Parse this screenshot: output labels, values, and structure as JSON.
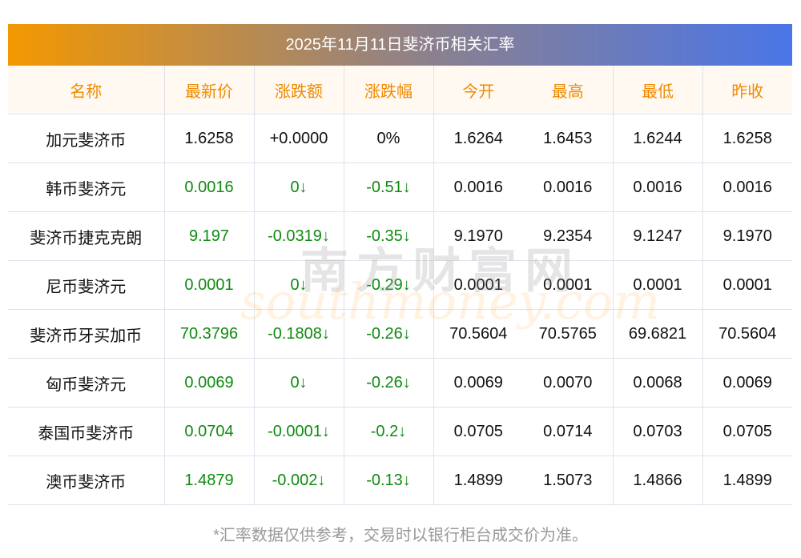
{
  "title": "2025年11月11日斐济币相关汇率",
  "headers": [
    "名称",
    "最新价",
    "涨跌额",
    "涨跌幅",
    "今开",
    "最高",
    "最低",
    "昨收"
  ],
  "rows": [
    [
      "加元斐济币",
      "1.6258",
      "+0.0000",
      "0%",
      "1.6264",
      "1.6453",
      "1.6244",
      "1.6258"
    ],
    [
      "韩币斐济元",
      "0.0016",
      "0↓",
      "-0.51↓",
      "0.0016",
      "0.0016",
      "0.0016",
      "0.0016"
    ],
    [
      "斐济币捷克克朗",
      "9.197",
      "-0.0319↓",
      "-0.35↓",
      "9.1970",
      "9.2354",
      "9.1247",
      "9.1970"
    ],
    [
      "尼币斐济元",
      "0.0001",
      "0↓",
      "-0.29↓",
      "0.0001",
      "0.0001",
      "0.0001",
      "0.0001"
    ],
    [
      "斐济币牙买加币",
      "70.3796",
      "-0.1808↓",
      "-0.26↓",
      "70.5604",
      "70.5765",
      "69.6821",
      "70.5604"
    ],
    [
      "匈币斐济元",
      "0.0069",
      "0↓",
      "-0.26↓",
      "0.0069",
      "0.0070",
      "0.0068",
      "0.0069"
    ],
    [
      "泰国币斐济币",
      "0.0704",
      "-0.0001↓",
      "-0.2↓",
      "0.0705",
      "0.0714",
      "0.0703",
      "0.0705"
    ],
    [
      "澳币斐济币",
      "1.4879",
      "-0.002↓",
      "-0.13↓",
      "1.4899",
      "1.5073",
      "1.4866",
      "1.4899"
    ]
  ],
  "row_green": [
    false,
    true,
    true,
    true,
    true,
    true,
    true,
    true
  ],
  "footer": "*汇率数据仅供参考，交易时以银行柜台成交价为准。",
  "watermark": {
    "cn": "南方财富网",
    "en": "southmoney.com"
  },
  "colors": {
    "header_text": "#f08a00",
    "down": "#108a10"
  }
}
